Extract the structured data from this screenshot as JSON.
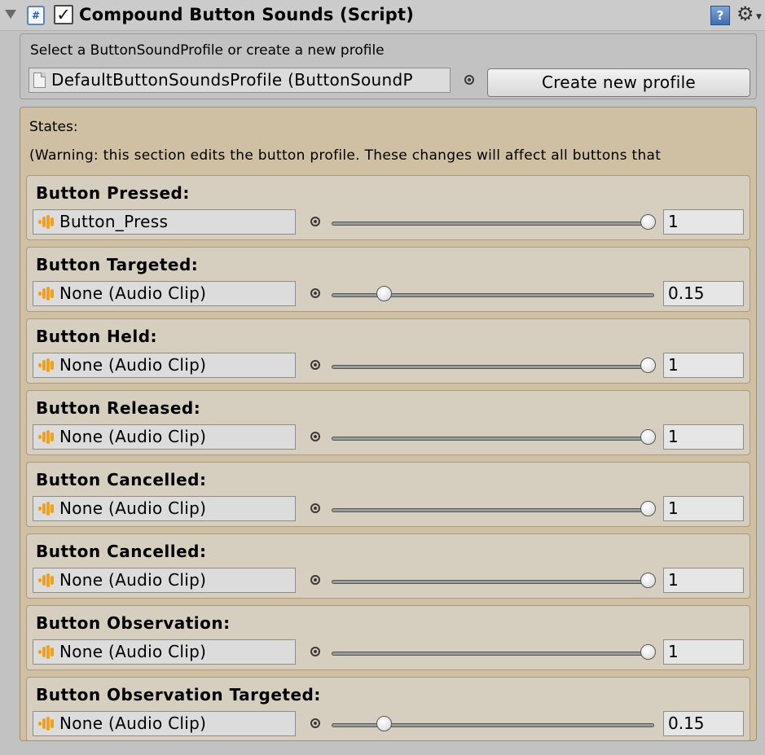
{
  "component": {
    "title": "Compound Button Sounds (Script)",
    "script_icon_glyph": "#",
    "enabled": true,
    "help_glyph": "?",
    "gear_glyph": "⚙"
  },
  "profile": {
    "prompt": "Select a ButtonSoundProfile or create a new profile",
    "field_value": "DefaultButtonSoundsProfile (ButtonSoundP",
    "create_button_label": "Create new profile"
  },
  "states_section": {
    "label": "States:",
    "warning": "(Warning: this section edits the button profile. These changes will affect all buttons that"
  },
  "states": [
    {
      "title": "Button Pressed:",
      "clip": "Button_Press",
      "volume": "1",
      "slider_fraction": 1.0
    },
    {
      "title": "Button Targeted:",
      "clip": "None (Audio Clip)",
      "volume": "0.15",
      "slider_fraction": 0.15
    },
    {
      "title": "Button Held:",
      "clip": "None (Audio Clip)",
      "volume": "1",
      "slider_fraction": 1.0
    },
    {
      "title": "Button Released:",
      "clip": "None (Audio Clip)",
      "volume": "1",
      "slider_fraction": 1.0
    },
    {
      "title": "Button Cancelled:",
      "clip": "None (Audio Clip)",
      "volume": "1",
      "slider_fraction": 1.0
    },
    {
      "title": "Button Cancelled:",
      "clip": "None (Audio Clip)",
      "volume": "1",
      "slider_fraction": 1.0
    },
    {
      "title": "Button Observation:",
      "clip": "None (Audio Clip)",
      "volume": "1",
      "slider_fraction": 1.0
    },
    {
      "title": "Button Observation Targeted:",
      "clip": "None (Audio Clip)",
      "volume": "0.15",
      "slider_fraction": 0.15
    }
  ],
  "colors": {
    "states_background": "#cfc0a3",
    "audio_icon": "#f0a020"
  }
}
